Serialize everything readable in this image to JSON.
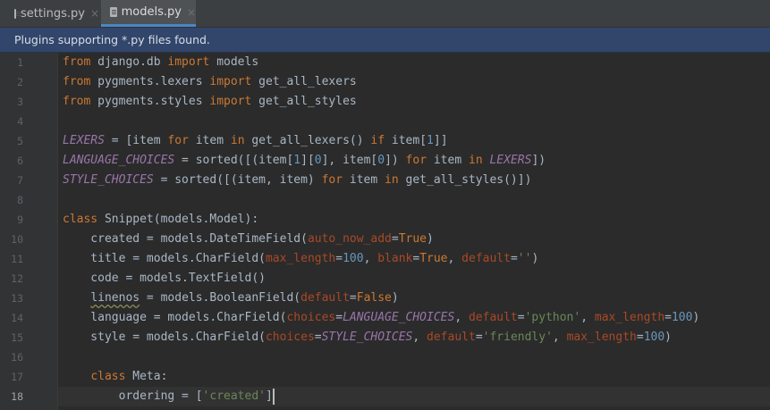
{
  "tabs": [
    {
      "label": "settings.py",
      "active": false
    },
    {
      "label": "models.py",
      "active": true
    }
  ],
  "icons": {
    "tab_close": "×",
    "file_icon": "python-file-icon",
    "bulb_icon": "lightbulb-icon"
  },
  "banner": {
    "text": "Plugins supporting *.py files found."
  },
  "editor": {
    "current_line": 18,
    "line_numbers": [
      "1",
      "2",
      "3",
      "4",
      "5",
      "6",
      "7",
      "8",
      "9",
      "10",
      "11",
      "12",
      "13",
      "14",
      "15",
      "16",
      "17",
      "18"
    ],
    "lines": [
      [
        {
          "t": "from",
          "c": "kw"
        },
        {
          "t": " django.db ",
          "c": ""
        },
        {
          "t": "import",
          "c": "kw"
        },
        {
          "t": " models",
          "c": ""
        }
      ],
      [
        {
          "t": "from",
          "c": "kw"
        },
        {
          "t": " pygments.lexers ",
          "c": ""
        },
        {
          "t": "import",
          "c": "kw"
        },
        {
          "t": " get_all_lexers",
          "c": ""
        }
      ],
      [
        {
          "t": "from",
          "c": "kw"
        },
        {
          "t": " pygments.styles ",
          "c": ""
        },
        {
          "t": "import",
          "c": "kw"
        },
        {
          "t": " get_all_styles",
          "c": ""
        }
      ],
      [],
      [
        {
          "t": "LEXERS",
          "c": "cn"
        },
        {
          "t": " = [item ",
          "c": ""
        },
        {
          "t": "for",
          "c": "kw"
        },
        {
          "t": " item ",
          "c": ""
        },
        {
          "t": "in",
          "c": "kw"
        },
        {
          "t": " get_all_lexers() ",
          "c": ""
        },
        {
          "t": "if",
          "c": "kw"
        },
        {
          "t": " item[",
          "c": ""
        },
        {
          "t": "1",
          "c": "nu"
        },
        {
          "t": "]]",
          "c": ""
        }
      ],
      [
        {
          "t": "LANGUAGE_CHOICES",
          "c": "cn"
        },
        {
          "t": " = sorted([(item[",
          "c": ""
        },
        {
          "t": "1",
          "c": "nu"
        },
        {
          "t": "][",
          "c": ""
        },
        {
          "t": "0",
          "c": "nu"
        },
        {
          "t": "], item[",
          "c": ""
        },
        {
          "t": "0",
          "c": "nu"
        },
        {
          "t": "]) ",
          "c": ""
        },
        {
          "t": "for",
          "c": "kw"
        },
        {
          "t": " item ",
          "c": ""
        },
        {
          "t": "in",
          "c": "kw"
        },
        {
          "t": " ",
          "c": ""
        },
        {
          "t": "LEXERS",
          "c": "cn"
        },
        {
          "t": "])",
          "c": ""
        }
      ],
      [
        {
          "t": "STYLE_CHOICES",
          "c": "cn"
        },
        {
          "t": " = sorted([(item, item) ",
          "c": ""
        },
        {
          "t": "for",
          "c": "kw"
        },
        {
          "t": " item ",
          "c": ""
        },
        {
          "t": "in",
          "c": "kw"
        },
        {
          "t": " get_all_styles()])",
          "c": ""
        }
      ],
      [],
      [
        {
          "t": "class",
          "c": "kw"
        },
        {
          "t": " Snippet(models.Model):",
          "c": ""
        }
      ],
      [
        {
          "t": "    created = models.DateTimeField(",
          "c": ""
        },
        {
          "t": "auto_now_add",
          "c": "pa"
        },
        {
          "t": "=",
          "c": ""
        },
        {
          "t": "True",
          "c": "kw"
        },
        {
          "t": ")",
          "c": ""
        }
      ],
      [
        {
          "t": "    title = models.CharField(",
          "c": ""
        },
        {
          "t": "max_length",
          "c": "pa"
        },
        {
          "t": "=",
          "c": ""
        },
        {
          "t": "100",
          "c": "nu"
        },
        {
          "t": ", ",
          "c": ""
        },
        {
          "t": "blank",
          "c": "pa"
        },
        {
          "t": "=",
          "c": ""
        },
        {
          "t": "True",
          "c": "kw"
        },
        {
          "t": ", ",
          "c": ""
        },
        {
          "t": "default",
          "c": "pa"
        },
        {
          "t": "=",
          "c": ""
        },
        {
          "t": "''",
          "c": "st"
        },
        {
          "t": ")",
          "c": ""
        }
      ],
      [
        {
          "t": "    code = models.TextField()",
          "c": ""
        }
      ],
      [
        {
          "t": "    ",
          "c": ""
        },
        {
          "t": "linenos",
          "c": "squig"
        },
        {
          "t": " = models.BooleanField(",
          "c": ""
        },
        {
          "t": "default",
          "c": "pa"
        },
        {
          "t": "=",
          "c": ""
        },
        {
          "t": "False",
          "c": "kw"
        },
        {
          "t": ")",
          "c": ""
        }
      ],
      [
        {
          "t": "    language = models.CharField(",
          "c": ""
        },
        {
          "t": "choices",
          "c": "pa"
        },
        {
          "t": "=",
          "c": ""
        },
        {
          "t": "LANGUAGE_CHOICES",
          "c": "cn"
        },
        {
          "t": ", ",
          "c": ""
        },
        {
          "t": "default",
          "c": "pa"
        },
        {
          "t": "=",
          "c": ""
        },
        {
          "t": "'python'",
          "c": "st"
        },
        {
          "t": ", ",
          "c": ""
        },
        {
          "t": "max_length",
          "c": "pa"
        },
        {
          "t": "=",
          "c": ""
        },
        {
          "t": "100",
          "c": "nu"
        },
        {
          "t": ")",
          "c": ""
        }
      ],
      [
        {
          "t": "    style = models.CharField(",
          "c": ""
        },
        {
          "t": "choices",
          "c": "pa"
        },
        {
          "t": "=",
          "c": ""
        },
        {
          "t": "STYLE_CHOICES",
          "c": "cn"
        },
        {
          "t": ", ",
          "c": ""
        },
        {
          "t": "default",
          "c": "pa"
        },
        {
          "t": "=",
          "c": ""
        },
        {
          "t": "'friendly'",
          "c": "st"
        },
        {
          "t": ", ",
          "c": ""
        },
        {
          "t": "max_length",
          "c": "pa"
        },
        {
          "t": "=",
          "c": ""
        },
        {
          "t": "100",
          "c": "nu"
        },
        {
          "t": ")",
          "c": ""
        }
      ],
      [],
      [
        {
          "t": "    ",
          "c": ""
        },
        {
          "t": "class",
          "c": "kw"
        },
        {
          "t": " Meta:",
          "c": ""
        }
      ],
      [
        {
          "t": "        ordering = [",
          "c": ""
        },
        {
          "t": "'created'",
          "c": "st"
        },
        {
          "t": "]",
          "c": ""
        }
      ]
    ]
  },
  "colors": {
    "background": "#2b2b2b",
    "keyword": "#cc7832",
    "constant": "#9876aa",
    "number": "#6897bb",
    "string": "#6a8759",
    "param": "#aa4926",
    "banner": "#32466b"
  }
}
